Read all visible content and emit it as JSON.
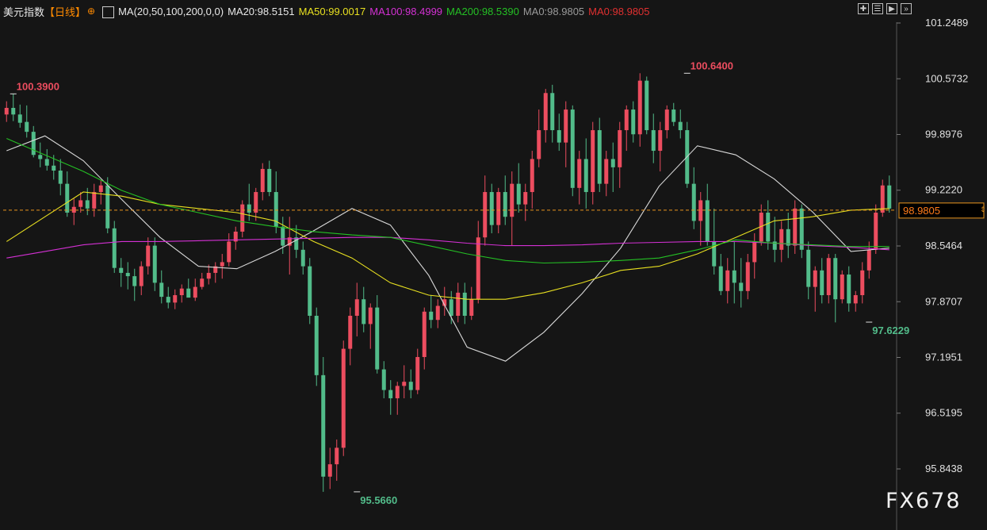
{
  "header": {
    "instrument": "美元指数",
    "period": "【日线】",
    "ma_params": "MA(20,50,100,200,0,0)",
    "ma20": "MA20:98.5151",
    "ma50": "MA50:99.0017",
    "ma100": "MA100:98.4999",
    "ma200": "MA200:98.5390",
    "ma0a": "MA0:98.9805",
    "ma0b": "MA0:98.9805"
  },
  "toolbar": {
    "buttons": [
      "add-panel-icon",
      "list-icon",
      "play-icon",
      "fast-forward-icon"
    ]
  },
  "watermark": "FX678",
  "colors": {
    "background": "#151515",
    "up": "#ec4d5f",
    "down": "#52bc8a",
    "ma20": "#d8d8d8",
    "ma50": "#e8e020",
    "ma100": "#d430d4",
    "ma200": "#24c024",
    "ma0a": "#999999",
    "ma0b": "#e03030",
    "current_price_line": "#e8941e"
  },
  "chart_data": {
    "type": "candlestick",
    "y_ticks": [
      "101.2489",
      "100.5732",
      "99.8976",
      "99.2220",
      "98.5464",
      "97.8707",
      "97.1951",
      "96.5195",
      "95.8438"
    ],
    "ylim": [
      95.54,
      101.25
    ],
    "current_price": "98.9805",
    "annotations": [
      {
        "text": "100.3900",
        "value": 100.39,
        "index": 1,
        "kind": "high"
      },
      {
        "text": "100.6400",
        "value": 100.64,
        "index": 101,
        "kind": "high"
      },
      {
        "text": "95.5660",
        "value": 95.566,
        "index": 52,
        "kind": "low"
      },
      {
        "text": "97.6229",
        "value": 97.6229,
        "index": 128,
        "kind": "low"
      }
    ],
    "ohlc": [
      [
        100.14,
        100.3,
        100.05,
        100.22
      ],
      [
        100.22,
        100.39,
        100.06,
        100.14
      ],
      [
        100.14,
        100.26,
        99.98,
        100.04
      ],
      [
        100.05,
        100.25,
        99.86,
        99.93
      ],
      [
        99.93,
        100.0,
        99.62,
        99.65
      ],
      [
        99.65,
        99.8,
        99.5,
        99.6
      ],
      [
        99.6,
        99.72,
        99.46,
        99.52
      ],
      [
        99.52,
        99.65,
        99.35,
        99.46
      ],
      [
        99.46,
        99.6,
        99.16,
        99.3
      ],
      [
        99.3,
        99.45,
        98.9,
        98.95
      ],
      [
        98.95,
        99.12,
        98.8,
        99.02
      ],
      [
        99.02,
        99.2,
        98.95,
        99.1
      ],
      [
        99.1,
        99.25,
        98.92,
        99.0
      ],
      [
        99.0,
        99.3,
        98.9,
        99.2
      ],
      [
        99.2,
        99.35,
        99.05,
        99.28
      ],
      [
        99.28,
        99.38,
        98.7,
        98.76
      ],
      [
        98.76,
        98.85,
        98.22,
        98.28
      ],
      [
        98.28,
        98.4,
        98.05,
        98.22
      ],
      [
        98.22,
        98.35,
        98.02,
        98.18
      ],
      [
        98.18,
        98.27,
        97.88,
        98.06
      ],
      [
        98.06,
        98.36,
        97.95,
        98.3
      ],
      [
        98.3,
        98.65,
        98.2,
        98.55
      ],
      [
        98.55,
        98.65,
        98.0,
        98.1
      ],
      [
        98.1,
        98.25,
        97.85,
        97.93
      ],
      [
        97.93,
        98.05,
        97.79,
        97.86
      ],
      [
        97.86,
        98.02,
        97.78,
        97.95
      ],
      [
        97.95,
        98.08,
        97.86,
        98.03
      ],
      [
        98.03,
        98.15,
        97.93,
        97.92
      ],
      [
        97.92,
        98.15,
        97.88,
        98.05
      ],
      [
        98.05,
        98.22,
        98.02,
        98.15
      ],
      [
        98.15,
        98.32,
        98.08,
        98.22
      ],
      [
        98.22,
        98.35,
        98.1,
        98.3
      ],
      [
        98.3,
        98.45,
        98.15,
        98.35
      ],
      [
        98.35,
        98.7,
        98.3,
        98.6
      ],
      [
        98.6,
        98.78,
        98.5,
        98.72
      ],
      [
        98.72,
        99.1,
        98.65,
        99.05
      ],
      [
        99.05,
        99.3,
        98.85,
        98.95
      ],
      [
        98.95,
        99.25,
        98.85,
        99.2
      ],
      [
        99.2,
        99.55,
        99.1,
        99.48
      ],
      [
        99.48,
        99.58,
        99.15,
        99.2
      ],
      [
        99.2,
        99.45,
        98.7,
        98.78
      ],
      [
        98.78,
        98.9,
        98.45,
        98.55
      ],
      [
        98.55,
        98.9,
        98.2,
        98.65
      ],
      [
        98.65,
        98.8,
        98.4,
        98.5
      ],
      [
        98.5,
        98.6,
        98.2,
        98.3
      ],
      [
        98.3,
        98.4,
        97.6,
        97.7
      ],
      [
        97.7,
        97.8,
        96.85,
        96.98
      ],
      [
        96.98,
        97.2,
        95.566,
        95.75
      ],
      [
        95.75,
        96.1,
        95.6,
        95.9
      ],
      [
        95.9,
        96.2,
        95.7,
        96.1
      ],
      [
        96.1,
        97.4,
        96.0,
        97.3
      ],
      [
        97.3,
        97.8,
        97.1,
        97.7
      ],
      [
        97.7,
        98.1,
        97.45,
        97.9
      ],
      [
        97.9,
        98.05,
        97.5,
        97.6
      ],
      [
        97.6,
        97.85,
        97.3,
        97.8
      ],
      [
        97.8,
        97.95,
        97.0,
        97.05
      ],
      [
        97.05,
        97.15,
        96.7,
        96.8
      ],
      [
        96.8,
        96.92,
        96.5,
        96.7
      ],
      [
        96.7,
        96.9,
        96.5,
        96.85
      ],
      [
        96.85,
        97.1,
        96.7,
        96.9
      ],
      [
        96.9,
        97.05,
        96.7,
        96.8
      ],
      [
        96.8,
        97.3,
        96.75,
        97.2
      ],
      [
        97.2,
        97.8,
        97.05,
        97.75
      ],
      [
        97.75,
        97.95,
        97.55,
        97.65
      ],
      [
        97.65,
        97.9,
        97.55,
        97.82
      ],
      [
        97.82,
        98.05,
        97.7,
        97.9
      ],
      [
        97.9,
        98.0,
        97.6,
        97.7
      ],
      [
        97.7,
        98.1,
        97.62,
        97.98
      ],
      [
        97.98,
        98.1,
        97.6,
        97.7
      ],
      [
        97.7,
        98.05,
        97.65,
        97.9
      ],
      [
        97.9,
        98.85,
        97.85,
        98.65
      ],
      [
        98.65,
        99.4,
        98.55,
        99.2
      ],
      [
        99.2,
        99.3,
        98.7,
        98.8
      ],
      [
        98.8,
        99.25,
        98.7,
        99.2
      ],
      [
        99.2,
        99.4,
        98.8,
        98.9
      ],
      [
        98.9,
        99.45,
        98.55,
        99.3
      ],
      [
        99.3,
        99.55,
        98.95,
        99.05
      ],
      [
        99.05,
        99.3,
        98.85,
        99.2
      ],
      [
        99.2,
        99.7,
        99.0,
        99.6
      ],
      [
        99.6,
        100.2,
        99.5,
        99.95
      ],
      [
        99.95,
        100.45,
        99.8,
        100.4
      ],
      [
        100.4,
        100.5,
        99.8,
        99.95
      ],
      [
        99.95,
        100.15,
        99.7,
        99.8
      ],
      [
        99.8,
        100.3,
        99.5,
        100.2
      ],
      [
        100.2,
        100.25,
        99.15,
        99.25
      ],
      [
        99.25,
        99.7,
        99.05,
        99.6
      ],
      [
        99.6,
        99.85,
        99.0,
        99.2
      ],
      [
        99.2,
        100.05,
        99.05,
        99.95
      ],
      [
        99.95,
        100.1,
        99.2,
        99.3
      ],
      [
        99.3,
        99.7,
        99.15,
        99.6
      ],
      [
        99.6,
        99.8,
        99.2,
        99.5
      ],
      [
        99.5,
        100.05,
        99.25,
        99.95
      ],
      [
        99.95,
        100.25,
        99.7,
        100.2
      ],
      [
        100.2,
        100.3,
        99.8,
        99.9
      ],
      [
        99.9,
        100.64,
        99.75,
        100.55
      ],
      [
        100.55,
        100.6,
        99.9,
        99.95
      ],
      [
        99.95,
        100.15,
        99.55,
        99.7
      ],
      [
        99.7,
        100.05,
        99.45,
        99.95
      ],
      [
        99.95,
        100.25,
        99.85,
        100.2
      ],
      [
        100.2,
        100.28,
        100.0,
        100.05
      ],
      [
        100.05,
        100.2,
        99.85,
        99.95
      ],
      [
        99.95,
        100.05,
        99.25,
        99.3
      ],
      [
        99.3,
        99.5,
        98.75,
        98.85
      ],
      [
        98.85,
        99.2,
        98.55,
        99.1
      ],
      [
        99.1,
        99.3,
        98.55,
        98.6
      ],
      [
        98.6,
        99.0,
        98.2,
        98.3
      ],
      [
        98.3,
        98.45,
        97.95,
        98.0
      ],
      [
        98.0,
        98.4,
        97.85,
        98.25
      ],
      [
        98.25,
        98.6,
        97.85,
        98.1
      ],
      [
        98.1,
        98.4,
        97.8,
        98.0
      ],
      [
        98.0,
        98.45,
        97.9,
        98.35
      ],
      [
        98.35,
        98.7,
        98.15,
        98.6
      ],
      [
        98.6,
        99.05,
        98.55,
        98.95
      ],
      [
        98.95,
        99.1,
        98.5,
        98.6
      ],
      [
        98.6,
        98.9,
        98.35,
        98.5
      ],
      [
        98.5,
        98.85,
        98.35,
        98.75
      ],
      [
        98.75,
        98.95,
        98.4,
        98.55
      ],
      [
        98.55,
        99.1,
        98.45,
        99.0
      ],
      [
        99.0,
        99.05,
        98.4,
        98.5
      ],
      [
        98.5,
        98.6,
        97.9,
        98.05
      ],
      [
        98.05,
        98.3,
        97.75,
        98.25
      ],
      [
        98.25,
        98.4,
        97.85,
        97.95
      ],
      [
        97.95,
        98.45,
        97.85,
        98.4
      ],
      [
        98.4,
        98.45,
        97.62,
        97.9
      ],
      [
        97.9,
        98.25,
        97.85,
        98.2
      ],
      [
        98.2,
        98.3,
        97.75,
        97.85
      ],
      [
        97.85,
        98.0,
        97.75,
        97.95
      ],
      [
        97.95,
        98.35,
        97.85,
        98.25
      ],
      [
        98.25,
        98.6,
        98.15,
        98.5
      ],
      [
        98.5,
        99.05,
        98.45,
        98.95
      ],
      [
        98.95,
        99.35,
        98.9,
        99.28
      ],
      [
        99.28,
        99.4,
        98.95,
        99.0
      ]
    ],
    "ma_lines": [
      {
        "name": "MA20",
        "values": [
          99.7,
          99.88,
          99.58,
          99.11,
          98.65,
          98.3,
          98.27,
          98.48,
          98.73,
          99.0,
          98.8,
          98.19,
          97.32,
          97.15,
          97.5,
          97.97,
          98.52,
          99.27,
          99.76,
          99.65,
          99.36,
          98.96,
          98.48,
          98.52
        ]
      },
      {
        "name": "MA50",
        "values": [
          98.6,
          98.9,
          99.2,
          99.15,
          99.05,
          99.0,
          98.95,
          98.85,
          98.6,
          98.4,
          98.1,
          97.95,
          97.9,
          97.9,
          97.98,
          98.1,
          98.25,
          98.3,
          98.45,
          98.65,
          98.85,
          98.9,
          98.98,
          99.0
        ]
      },
      {
        "name": "MA100",
        "values": [
          98.4,
          98.48,
          98.56,
          98.6,
          98.6,
          98.61,
          98.62,
          98.63,
          98.64,
          98.65,
          98.65,
          98.62,
          98.58,
          98.55,
          98.55,
          98.56,
          98.58,
          98.59,
          98.6,
          98.6,
          98.58,
          98.55,
          98.53,
          98.5
        ]
      },
      {
        "name": "MA200",
        "values": [
          99.85,
          99.65,
          99.45,
          99.22,
          99.05,
          98.95,
          98.85,
          98.78,
          98.72,
          98.68,
          98.65,
          98.55,
          98.45,
          98.37,
          98.34,
          98.35,
          98.37,
          98.4,
          98.5,
          98.62,
          98.58,
          98.56,
          98.54,
          98.54
        ]
      }
    ]
  }
}
